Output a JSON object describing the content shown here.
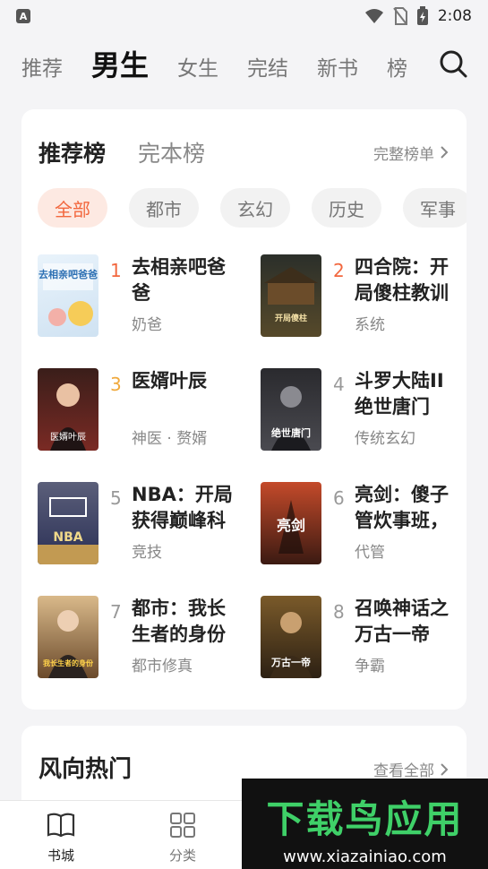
{
  "status_bar": {
    "app_badge": "A",
    "time": "2:08"
  },
  "top_nav": {
    "tabs": [
      {
        "label": "推荐"
      },
      {
        "label": "男生"
      },
      {
        "label": "女生"
      },
      {
        "label": "完结"
      },
      {
        "label": "新书"
      },
      {
        "label": "榜"
      }
    ],
    "active_tab": "男生"
  },
  "ranking_card": {
    "tabs": [
      "推荐榜",
      "完本榜"
    ],
    "more_label": "完整榜单",
    "chips": [
      "全部",
      "都市",
      "玄幻",
      "历史",
      "军事"
    ],
    "books": [
      {
        "rank": "1",
        "title": "去相亲吧爸爸",
        "tag": "奶爸",
        "cover_text": "去相亲吧爸爸"
      },
      {
        "rank": "2",
        "title": "四合院：开局傻柱教训",
        "tag": "系统",
        "cover_text": "开局傻柱"
      },
      {
        "rank": "3",
        "title": "医婿叶辰",
        "tag": "神医 · 赘婿",
        "cover_text": "医婿叶辰"
      },
      {
        "rank": "4",
        "title": "斗罗大陆II绝世唐门",
        "tag": "传统玄幻",
        "cover_text": "绝世唐门"
      },
      {
        "rank": "5",
        "title": "NBA：开局获得巅峰科",
        "tag": "竞技",
        "cover_text": "NBA"
      },
      {
        "rank": "6",
        "title": "亮剑：傻子管炊事班，",
        "tag": "代管",
        "cover_text": "亮剑"
      },
      {
        "rank": "7",
        "title": "都市：我长生者的身份",
        "tag": "都市修真",
        "cover_text": "我长生者的身份"
      },
      {
        "rank": "8",
        "title": "召唤神话之万古一帝",
        "tag": "争霸",
        "cover_text": "万古一帝"
      }
    ]
  },
  "hot_card": {
    "title": "风向热门",
    "more_label": "查看全部"
  },
  "bottom_nav": {
    "items": [
      {
        "label": "书城",
        "icon": "book-icon"
      },
      {
        "label": "分类",
        "icon": "grid-icon"
      }
    ]
  },
  "watermark": {
    "title": "下载鸟应用",
    "url": "www.xiazainiao.com"
  },
  "colors": {
    "accent": "#f2673e",
    "rank_gold": "#f0a93c",
    "chip_active_bg": "#fde9e2"
  }
}
